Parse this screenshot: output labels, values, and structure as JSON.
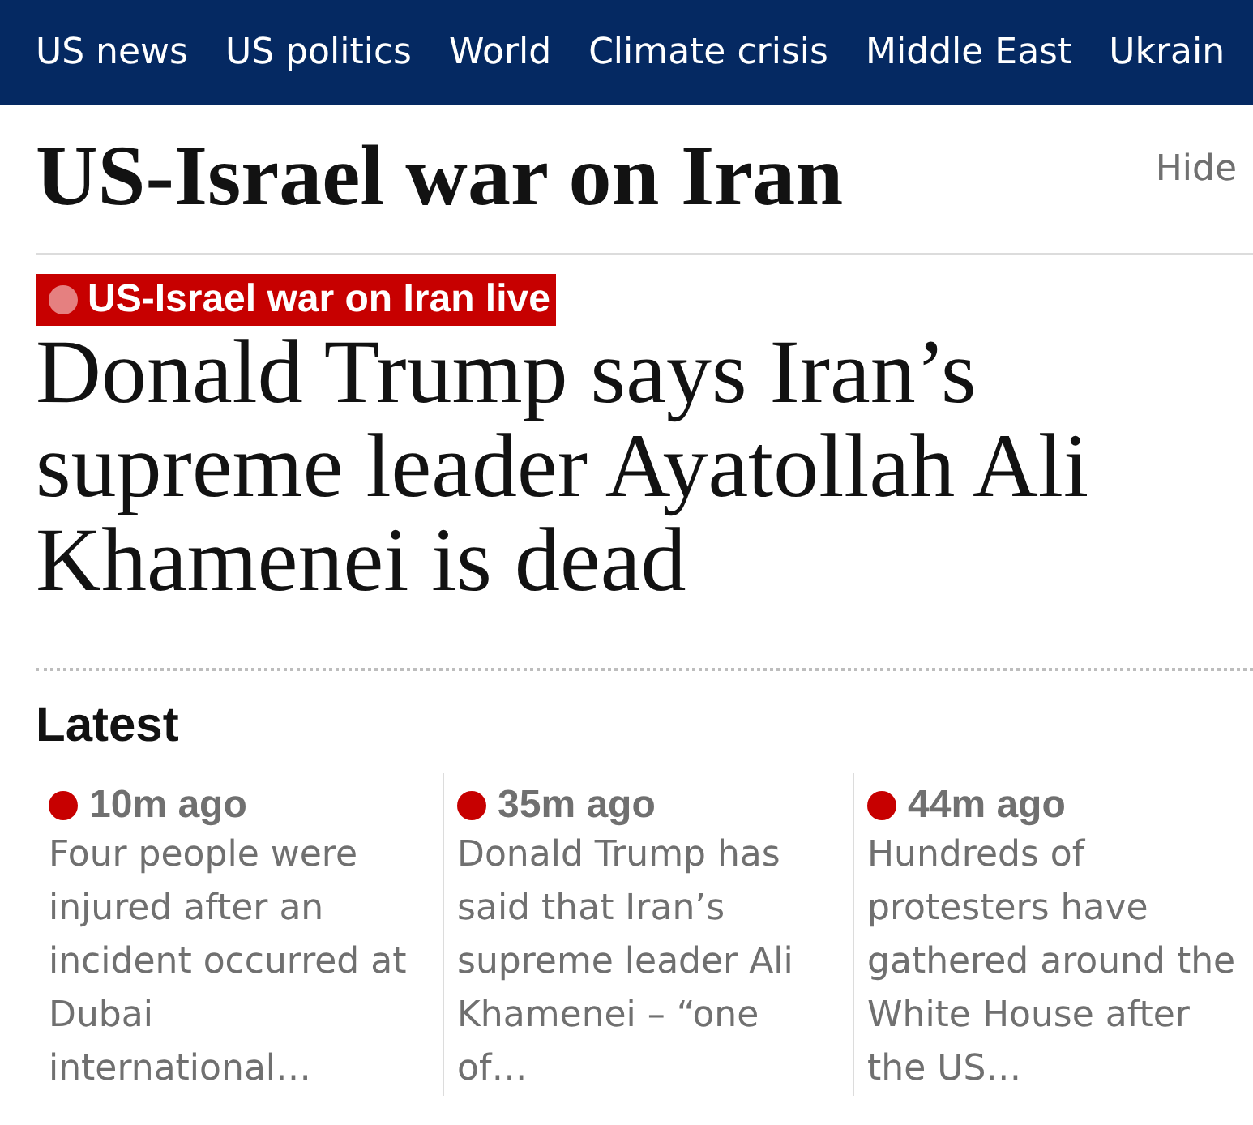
{
  "nav": {
    "items": [
      "US news",
      "US politics",
      "World",
      "Climate crisis",
      "Middle East",
      "Ukrain"
    ]
  },
  "section": {
    "title": "US-Israel war on Iran",
    "hide_label": "Hide"
  },
  "article": {
    "kicker": "US-Israel war on Iran live",
    "live": true,
    "headline": "Donald Trump says Iran’s supreme leader Ayatollah Ali Khamenei is dead"
  },
  "latest": {
    "heading": "Latest",
    "items": [
      {
        "time": "10m ago",
        "summary": "Four people were injured after an incident occurred at Dubai international…"
      },
      {
        "time": "35m ago",
        "summary": "Donald Trump has said that Iran’s supreme leader Ali Khamenei – “one of…"
      },
      {
        "time": "44m ago",
        "summary": "Hundreds of protesters have gathered around the White House after the US…"
      }
    ]
  }
}
